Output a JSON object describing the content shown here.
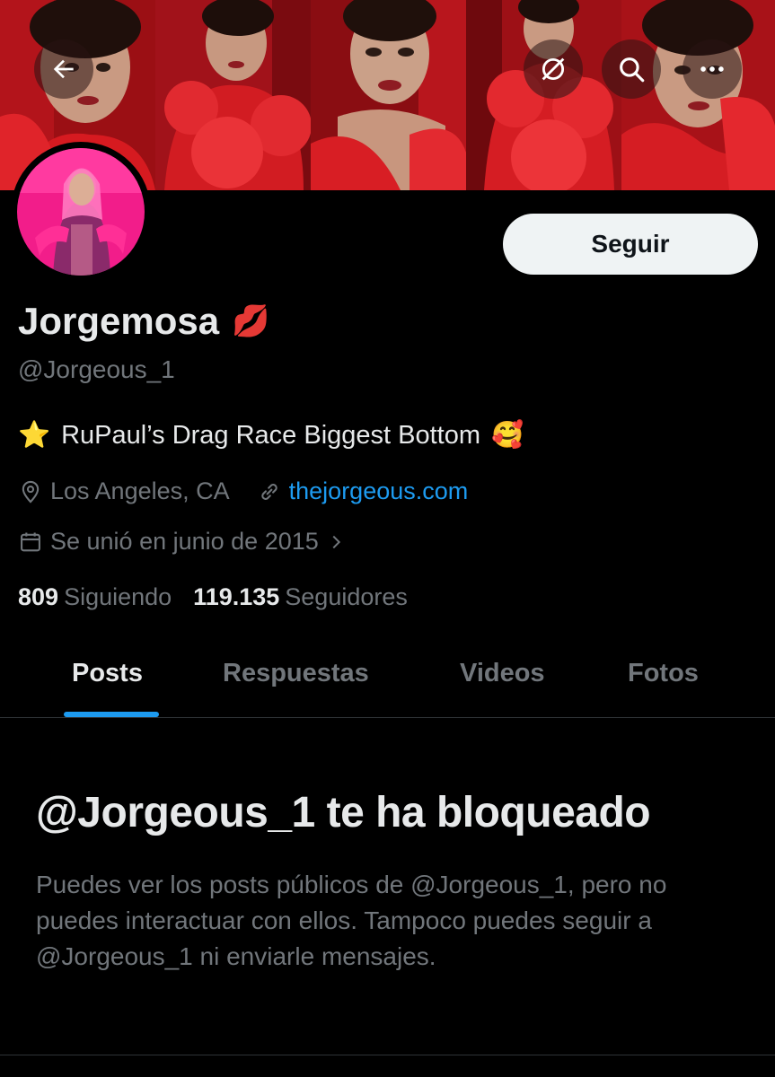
{
  "profile": {
    "display_name": "Jorgemosa",
    "name_emoji": "💋",
    "handle": "@Jorgeous_1",
    "bio_star": "⭐",
    "bio_text": "RuPaul’s Drag Race Biggest Bottom",
    "bio_emoji": "🥰",
    "location": "Los Angeles, CA",
    "website": "thejorgeous.com",
    "joined": "Se unió en junio de 2015",
    "following_count": "809",
    "following_label": "Siguiendo",
    "followers_count": "119.135",
    "followers_label": "Seguidores"
  },
  "actions": {
    "follow_label": "Seguir"
  },
  "tabs": [
    {
      "label": "Posts"
    },
    {
      "label": "Respuestas"
    },
    {
      "label": "Videos"
    },
    {
      "label": "Fotos"
    }
  ],
  "blocked": {
    "title": "@Jorgeous_1 te ha bloqueado",
    "description": "Puedes ver los posts públicos de @Jorgeous_1, pero no puedes interactuar con ellos. Tampoco puedes seguir a @Jorgeous_1 ni enviarle mensajes."
  },
  "icons": {
    "back": "arrow-left-icon",
    "translate": "no-translate-icon",
    "search": "search-icon",
    "more": "more-icon",
    "location": "location-pin-icon",
    "link": "link-icon",
    "calendar": "calendar-icon",
    "chevron": "chevron-right-icon"
  },
  "colors": {
    "accent": "#1d9bf0",
    "background": "#000000",
    "text_primary": "#e7e9ea",
    "text_secondary": "#71767b",
    "banner_red": "#c4121a"
  }
}
